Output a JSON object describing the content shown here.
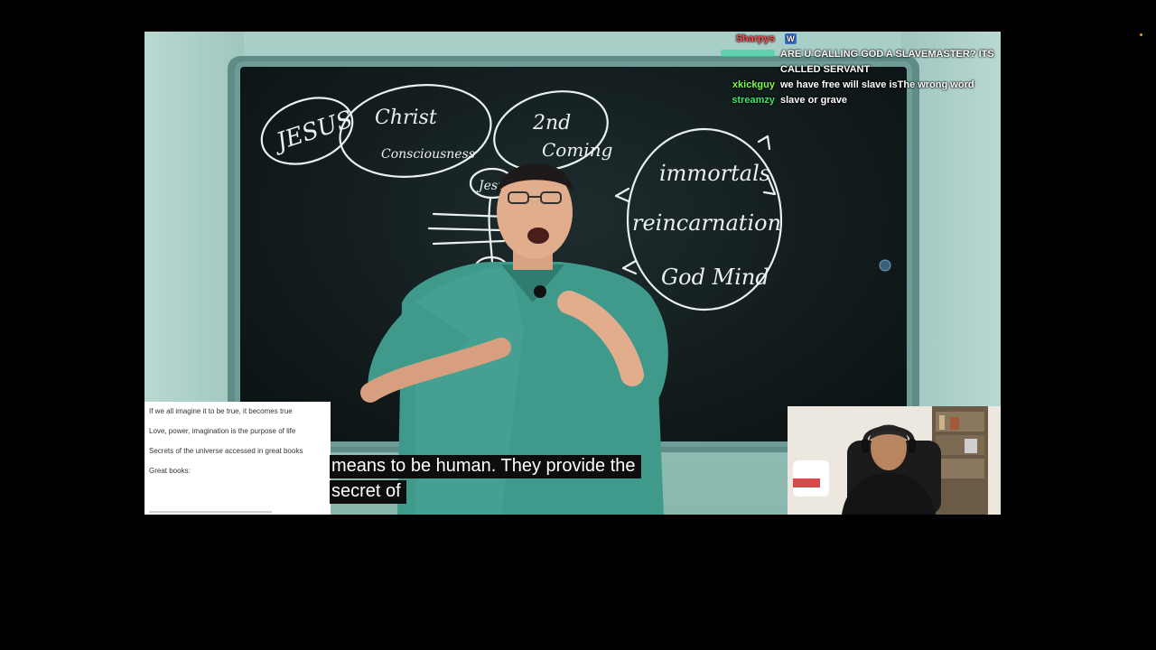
{
  "chat": {
    "messages": [
      {
        "user": "Sharpys",
        "user_color": "#ff4d4d",
        "badge": "W",
        "text": ""
      },
      {
        "user": "",
        "user_color": "#2ad49f",
        "text": "ARE U CALLING GOD A SLAVEMASTER? ITS"
      },
      {
        "user": "",
        "user_color": "#2ad49f",
        "text": "CALLED SERVANT"
      },
      {
        "user": "xkickguy",
        "user_color": "#7cfc48",
        "text": "we have free will slave isThe wrong word"
      },
      {
        "user": "streamzy",
        "user_color": "#3fe26a",
        "text": "slave or grave"
      }
    ]
  },
  "notes": {
    "lines": [
      "If we all imagine it to be true, it becomes true",
      "Love, power, imagination is the purpose of life",
      "Secrets of the universe accessed in great books",
      "Great books:"
    ]
  },
  "captions": {
    "line1": "means to be human. They provide the",
    "line2": "secret of"
  },
  "board": {
    "words": [
      "JESUS",
      "Christ",
      "Consciousness",
      "2nd",
      "Coming",
      "Jesus",
      "immortals",
      "reincarnation",
      "God Mind"
    ]
  },
  "colors": {
    "accent_chat_badge": "#3b6fd6",
    "recording_dot": "#e59a2a"
  }
}
